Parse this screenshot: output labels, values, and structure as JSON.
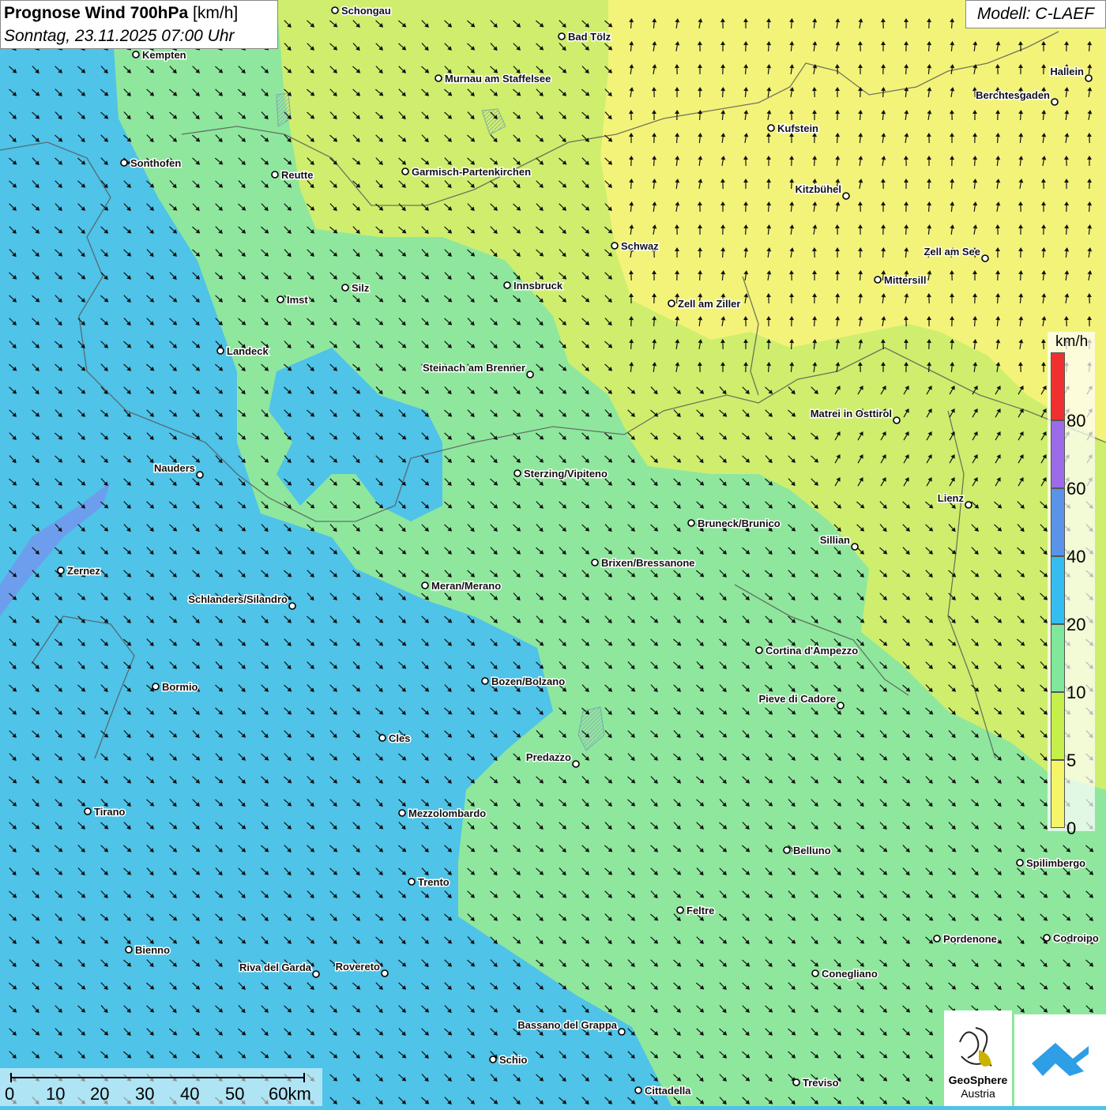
{
  "title": {
    "main": "Prognose Wind 700hPa",
    "unit": "[km/h]",
    "datetime": "Sonntag, 23.11.2025 07:00 Uhr"
  },
  "model": "Modell: C-LAEF",
  "legend": {
    "unit": "km/h",
    "ticks": [
      "80",
      "60",
      "40",
      "20",
      "10",
      "5",
      "0"
    ],
    "colors": [
      "#f03030",
      "#9b6be8",
      "#5a93e8",
      "#36bdf0",
      "#7fe89a",
      "#c5ef4a",
      "#f5f56a"
    ]
  },
  "scalebar": {
    "labels": [
      "0",
      "10",
      "20",
      "30",
      "40",
      "50",
      "60km"
    ]
  },
  "logos": {
    "geosphere_line1": "GeoSphere",
    "geosphere_line2": "Austria",
    "app_icon": "geosphere-app-icon"
  },
  "cities": [
    {
      "name": "Schongau"
    },
    {
      "name": "Bad Tölz"
    },
    {
      "name": "Kempten"
    },
    {
      "name": "Murnau am Staffelsee"
    },
    {
      "name": "Hallein"
    },
    {
      "name": "Berchtesgaden"
    },
    {
      "name": "Kufstein"
    },
    {
      "name": "Sonthofen"
    },
    {
      "name": "Reutte"
    },
    {
      "name": "Garmisch-Partenkirchen"
    },
    {
      "name": "Kitzbühel"
    },
    {
      "name": "Schwaz"
    },
    {
      "name": "Zell am See"
    },
    {
      "name": "Mittersill"
    },
    {
      "name": "Silz"
    },
    {
      "name": "Innsbruck"
    },
    {
      "name": "Imst"
    },
    {
      "name": "Zell am Ziller"
    },
    {
      "name": "Landeck"
    },
    {
      "name": "Steinach am Brenner"
    },
    {
      "name": "Matrei in Osttirol"
    },
    {
      "name": "Nauders"
    },
    {
      "name": "Sterzing/Vipiteno"
    },
    {
      "name": "Lienz"
    },
    {
      "name": "Bruneck/Brunico"
    },
    {
      "name": "Sillian"
    },
    {
      "name": "Brixen/Bressanone"
    },
    {
      "name": "Zernez"
    },
    {
      "name": "Meran/Merano"
    },
    {
      "name": "Schlanders/Silandro"
    },
    {
      "name": "Cortina d'Ampezzo"
    },
    {
      "name": "Bozen/Bolzano"
    },
    {
      "name": "Bormio"
    },
    {
      "name": "Pieve di Cadore"
    },
    {
      "name": "Cles"
    },
    {
      "name": "Predazzo"
    },
    {
      "name": "Tirano"
    },
    {
      "name": "Mezzolombardo"
    },
    {
      "name": "Belluno"
    },
    {
      "name": "Spilimbergo"
    },
    {
      "name": "Trento"
    },
    {
      "name": "Feltre"
    },
    {
      "name": "Pordenone"
    },
    {
      "name": "Codroipo"
    },
    {
      "name": "Bienno"
    },
    {
      "name": "Riva del Garda"
    },
    {
      "name": "Rovereto"
    },
    {
      "name": "Conegliano"
    },
    {
      "name": "Bassano del Grappa"
    },
    {
      "name": "Schio"
    },
    {
      "name": "Treviso"
    },
    {
      "name": "Cittadella"
    }
  ]
}
